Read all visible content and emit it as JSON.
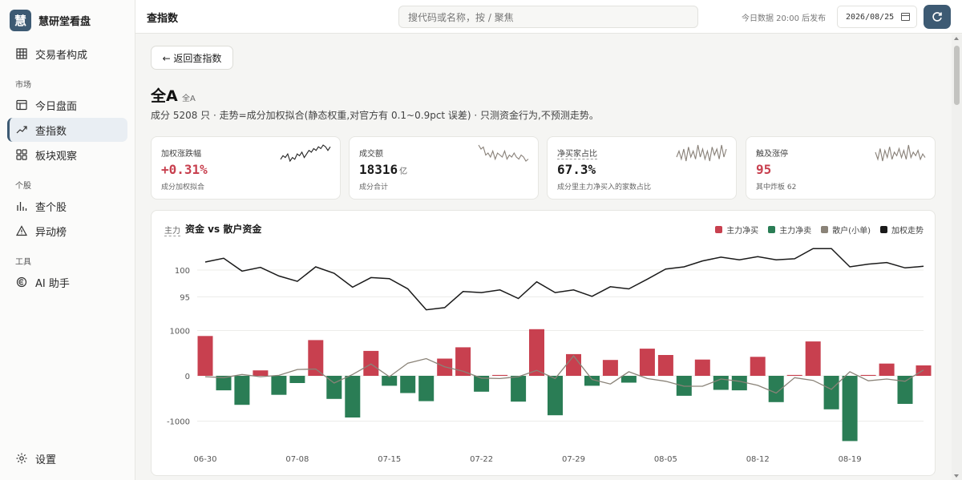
{
  "app": {
    "logo_char": "慧",
    "name": "慧研堂看盘"
  },
  "sidebar": {
    "top_item": {
      "label": "交易者构成",
      "icon": "grid-icon"
    },
    "sections": [
      {
        "label": "市场",
        "items": [
          {
            "label": "今日盘面",
            "icon": "layout-icon"
          },
          {
            "label": "查指数",
            "icon": "trend-icon",
            "active": true
          },
          {
            "label": "板块观察",
            "icon": "blocks-icon"
          }
        ]
      },
      {
        "label": "个股",
        "items": [
          {
            "label": "查个股",
            "icon": "bar-chart-icon"
          },
          {
            "label": "异动榜",
            "icon": "alert-triangle-icon"
          }
        ]
      },
      {
        "label": "工具",
        "items": [
          {
            "label": "AI 助手",
            "icon": "ai-icon"
          }
        ]
      }
    ],
    "settings_label": "设置"
  },
  "header": {
    "title": "查指数",
    "search_placeholder": "搜代码或名称，按 / 聚焦",
    "publish_note": "今日数据 20:00 后发布",
    "date_value": "2026/08/25"
  },
  "main": {
    "back_label": "← 返回查指数",
    "index_name": "全A",
    "index_sub": "全A",
    "description": "成分 5208 只 · 走势=成分加权拟合(静态权重,对官方有 0.1~0.9pct 误差) · 只测资金行为,不预测走势。"
  },
  "cards": [
    {
      "label": "加权涨跌幅",
      "value": "+0.31%",
      "unit": "",
      "note": "成分加权拟合",
      "red": true,
      "spark_color": "#222222",
      "spark": [
        5,
        7,
        6,
        8,
        4,
        6,
        5,
        8,
        7,
        9,
        6,
        8,
        10,
        9,
        11,
        10,
        12,
        11,
        13,
        12,
        10,
        12
      ]
    },
    {
      "label": "成交额",
      "value": "18316",
      "unit": "亿",
      "note": "成分合计",
      "red": false,
      "spark_color": "#888078",
      "spark": [
        12,
        10,
        11,
        7,
        8,
        6,
        9,
        5,
        8,
        7,
        6,
        9,
        5,
        7,
        6,
        8,
        6,
        5,
        7,
        6,
        4,
        5
      ]
    },
    {
      "label": "净买家占比",
      "value": "67.3%",
      "unit": "",
      "note": "成分里主力净买入的家数占比",
      "red": false,
      "dotted": true,
      "spark_color": "#888078",
      "spark": [
        6,
        9,
        5,
        10,
        4,
        11,
        6,
        9,
        5,
        12,
        6,
        10,
        5,
        9,
        4,
        11,
        7,
        10,
        5,
        12,
        6,
        10
      ]
    },
    {
      "label": "触及涨停",
      "value": "95",
      "unit": "",
      "note": "其中炸板 62",
      "red": true,
      "spark_color": "#888078",
      "spark": [
        8,
        4,
        10,
        3,
        9,
        5,
        11,
        4,
        8,
        6,
        10,
        5,
        9,
        4,
        12,
        5,
        8,
        6,
        9,
        4,
        7,
        5
      ]
    }
  ],
  "chart": {
    "tag": "主力",
    "title": "资金 vs 散户资金",
    "legend": [
      {
        "label": "主力净买",
        "color": "#c8404f"
      },
      {
        "label": "主力净卖",
        "color": "#2a7d55"
      },
      {
        "label": "散户(小单)",
        "color": "#8a8378"
      },
      {
        "label": "加权走势",
        "color": "#1a1a1a"
      }
    ]
  },
  "chart_data": {
    "type": "bar",
    "title": "资金 vs 散户资金",
    "series": [
      {
        "name": "主力净买/主力净卖",
        "type": "bar",
        "values": [
          880,
          -320,
          -640,
          120,
          -420,
          -160,
          790,
          -510,
          -920,
          550,
          -220,
          -380,
          -560,
          380,
          630,
          -350,
          20,
          -570,
          1030,
          -870,
          480,
          -220,
          350,
          -150,
          600,
          460,
          -440,
          360,
          -310,
          -320,
          420,
          -580,
          20,
          760,
          -740,
          -1440,
          20,
          270,
          -620,
          230
        ]
      },
      {
        "name": "散户(小单)",
        "type": "line",
        "values": [
          -20,
          -40,
          30,
          -20,
          10,
          140,
          150,
          -160,
          30,
          260,
          -20,
          280,
          380,
          200,
          100,
          -50,
          -60,
          -20,
          120,
          -60,
          440,
          -80,
          -180,
          90,
          -60,
          -120,
          -230,
          -230,
          -70,
          -120,
          -210,
          -380,
          -40,
          -100,
          -300,
          90,
          -110,
          -70,
          -120,
          130
        ]
      },
      {
        "name": "加权走势",
        "type": "line",
        "values": [
          101.5,
          102.2,
          99.8,
          100.5,
          98.9,
          97.9,
          100.6,
          99.4,
          96.8,
          98.6,
          98.4,
          96.5,
          92.6,
          93.0,
          96.0,
          95.8,
          96.3,
          94.7,
          97.8,
          95.8,
          96.3,
          95.1,
          96.9,
          96.5,
          98.3,
          100.2,
          100.6,
          101.7,
          102.4,
          101.9,
          102.5,
          101.9,
          102.1,
          104.0,
          104.0,
          100.6,
          101.1,
          101.4,
          100.4,
          100.7
        ]
      }
    ],
    "x_tick_labels": [
      "06-30",
      "07-08",
      "07-15",
      "07-22",
      "07-29",
      "08-05",
      "08-12",
      "08-19"
    ],
    "y_ticks_price": [
      100,
      95
    ],
    "y_ticks_flow": [
      1000,
      0,
      -1000
    ],
    "grid": true,
    "legend_position": "top-right"
  }
}
